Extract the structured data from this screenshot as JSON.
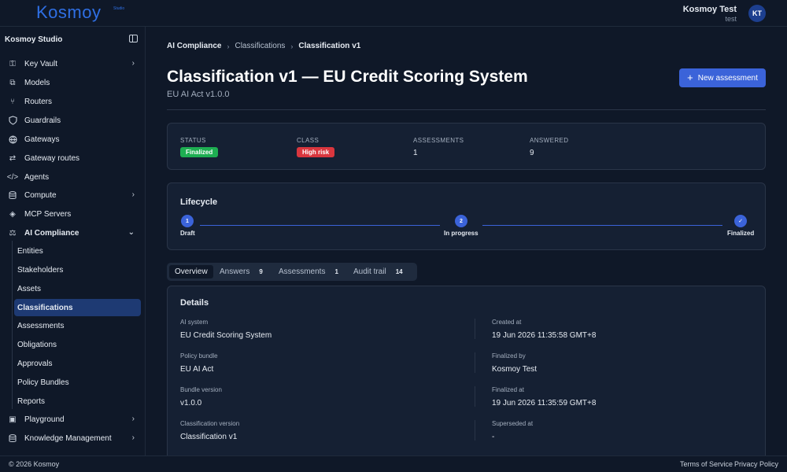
{
  "topbar": {
    "logo": "Kosmoy",
    "logo_sup": "Studio",
    "user_name": "Kosmoy Test",
    "user_sub": "test",
    "avatar_initials": "KT"
  },
  "sidebar": {
    "header": "Kosmoy Studio",
    "items": [
      {
        "label": "Key Vault",
        "icon": "key-icon",
        "chevron": true
      },
      {
        "label": "Models",
        "icon": "models-icon",
        "chevron": false
      },
      {
        "label": "Routers",
        "icon": "router-icon",
        "chevron": false
      },
      {
        "label": "Guardrails",
        "icon": "shield-icon",
        "chevron": false
      },
      {
        "label": "Gateways",
        "icon": "globe-icon",
        "chevron": false
      },
      {
        "label": "Gateway routes",
        "icon": "route-icon",
        "chevron": false
      },
      {
        "label": "Agents",
        "icon": "code-icon",
        "chevron": false
      },
      {
        "label": "Compute",
        "icon": "database-icon",
        "chevron": true
      },
      {
        "label": "MCP Servers",
        "icon": "mcp-icon",
        "chevron": false
      },
      {
        "label": "AI Compliance",
        "icon": "scale-icon",
        "chevron": true
      }
    ],
    "sub_items": [
      "Entities",
      "Stakeholders",
      "Assets",
      "Classifications",
      "Assessments",
      "Obligations",
      "Approvals",
      "Policy Bundles",
      "Reports"
    ],
    "bottom_items": [
      {
        "label": "Playground",
        "icon": "playground-icon"
      },
      {
        "label": "Knowledge Management",
        "icon": "database-icon"
      }
    ]
  },
  "breadcrumb": [
    "AI Compliance",
    "Classifications",
    "Classification v1"
  ],
  "page": {
    "title": "Classification v1 — EU Credit Scoring System",
    "subtitle": "EU AI Act v1.0.0",
    "new_button": "New assessment"
  },
  "stats": {
    "status_label": "STATUS",
    "status_value": "Finalized",
    "class_label": "CLASS",
    "class_value": "High risk",
    "assessments_label": "ASSESSMENTS",
    "assessments_value": "1",
    "answered_label": "ANSWERED",
    "answered_value": "9",
    "colors": {
      "finalized": "#1eae52",
      "high_risk": "#d9363e"
    }
  },
  "lifecycle": {
    "title": "Lifecycle",
    "steps": [
      {
        "num": "1",
        "label": "Draft"
      },
      {
        "num": "2",
        "label": "In progress"
      },
      {
        "num": "✓",
        "label": "Finalized"
      }
    ]
  },
  "tabs": [
    {
      "label": "Overview",
      "count": ""
    },
    {
      "label": "Answers",
      "count": "9"
    },
    {
      "label": "Assessments",
      "count": "1"
    },
    {
      "label": "Audit trail",
      "count": "14"
    }
  ],
  "details": {
    "title": "Details",
    "left": [
      {
        "label": "AI system",
        "value": "EU Credit Scoring System"
      },
      {
        "label": "Policy bundle",
        "value": "EU AI Act"
      },
      {
        "label": "Bundle version",
        "value": "v1.0.0"
      },
      {
        "label": "Classification version",
        "value": "Classification v1"
      }
    ],
    "right": [
      {
        "label": "Created at",
        "value": "19 Jun 2026 11:35:58 GMT+8"
      },
      {
        "label": "Finalized by",
        "value": "Kosmoy Test"
      },
      {
        "label": "Finalized at",
        "value": "19 Jun 2026 11:35:59 GMT+8"
      },
      {
        "label": "Superseded at",
        "value": "-"
      }
    ]
  },
  "footer": {
    "copyright": "© 2026 Kosmoy",
    "terms": "Terms of Service",
    "privacy": "Privacy Policy"
  }
}
